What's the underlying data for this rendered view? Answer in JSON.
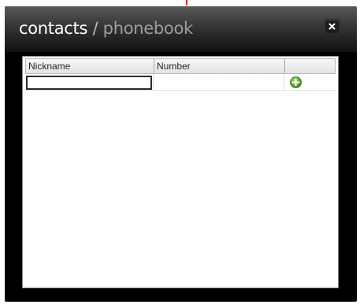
{
  "window": {
    "title_main": "contacts",
    "title_separator": " / ",
    "title_sub": "phonebook",
    "close_icon": "close-icon"
  },
  "grid": {
    "columns": [
      "Nickname",
      "Number",
      ""
    ],
    "new_row": {
      "nickname_value": "",
      "number_value": "",
      "action_icon": "add-icon"
    }
  },
  "colors": {
    "window_bg": "#000000",
    "accent_green": "#5aa02c",
    "top_marker_red": "#c0392b"
  }
}
